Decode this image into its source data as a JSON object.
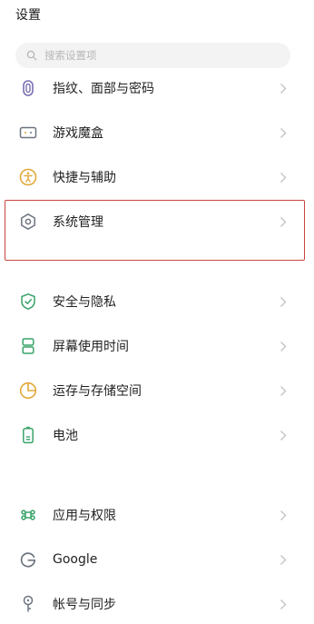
{
  "header": {
    "title": "设置"
  },
  "search": {
    "placeholder": "搜索设置项"
  },
  "groups": {
    "a": [
      {
        "label": "指纹、面部与密码",
        "icon": "fingerprint-icon"
      },
      {
        "label": "游戏魔盒",
        "icon": "game-box-icon"
      },
      {
        "label": "快捷与辅助",
        "icon": "accessibility-icon"
      },
      {
        "label": "系统管理",
        "icon": "system-management-icon"
      }
    ],
    "b": [
      {
        "label": "安全与隐私",
        "icon": "shield-icon"
      },
      {
        "label": "屏幕使用时间",
        "icon": "hourglass-icon"
      },
      {
        "label": "运存与存储空间",
        "icon": "storage-pie-icon"
      },
      {
        "label": "电池",
        "icon": "battery-icon"
      }
    ],
    "c": [
      {
        "label": "应用与权限",
        "icon": "apps-icon"
      },
      {
        "label": "Google",
        "icon": "google-icon"
      },
      {
        "label": "帐号与同步",
        "icon": "key-icon"
      }
    ]
  },
  "colors": {
    "icon_purple": "#7b6fb0",
    "icon_gold": "#e2a83a",
    "icon_gray": "#6d7480",
    "icon_green": "#3aa36b",
    "highlight_border": "#c9453f",
    "chevron": "#c4c4c4"
  }
}
